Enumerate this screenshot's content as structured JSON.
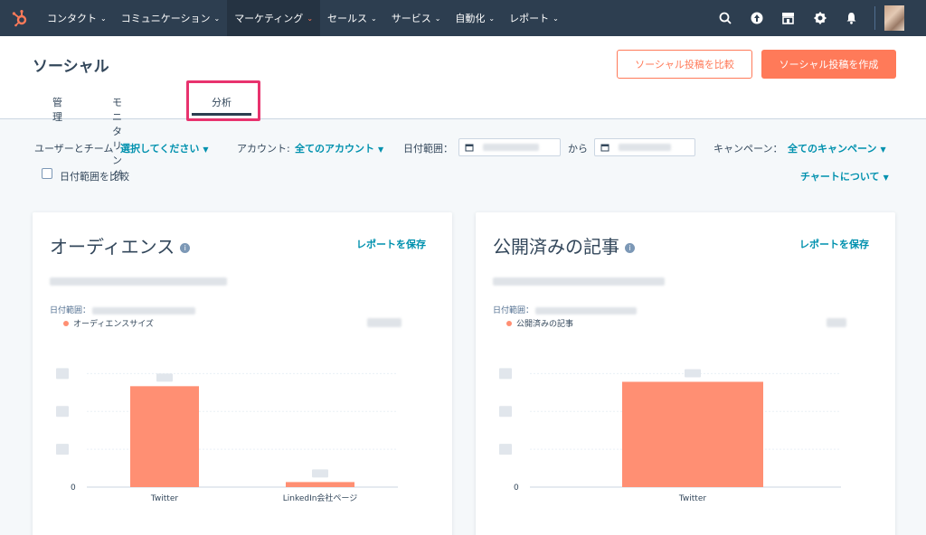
{
  "nav": {
    "items": [
      {
        "label": "コンタクト"
      },
      {
        "label": "コミュニケーション"
      },
      {
        "label": "マーケティング"
      },
      {
        "label": "セールス"
      },
      {
        "label": "サービス"
      },
      {
        "label": "自動化"
      },
      {
        "label": "レポート"
      }
    ],
    "active_index": 2,
    "icons": [
      "search-icon",
      "upgrade-icon",
      "marketplace-icon",
      "settings-icon",
      "notifications-icon"
    ],
    "colors": {
      "bg": "#2d3e50",
      "accent": "#ff7a59"
    }
  },
  "header": {
    "title": "ソーシャル",
    "compare_button": "ソーシャル投稿を比較",
    "create_button": "ソーシャル投稿を作成",
    "tabs": [
      {
        "label": "管理"
      },
      {
        "label": "モニタリング"
      },
      {
        "label": "分析"
      }
    ],
    "active_tab": 2
  },
  "filters": {
    "users_label": "ユーザーとチーム",
    "users_value": "選択してください",
    "account_label": "アカウント:",
    "account_value": "全てのアカウント",
    "date_label": "日付範囲：",
    "date_sep": "から",
    "campaign_label": "キャンペーン：",
    "campaign_value": "全てのキャンペーン",
    "compare_label": "日付範囲を比較",
    "compare_checked": false,
    "chart_about": "チャートについて"
  },
  "cards": [
    {
      "title": "オーディエンス",
      "save": "レポートを保存",
      "date_label": "日付範囲：",
      "legend": "オーディエンスサイズ",
      "chart_data": {
        "type": "bar",
        "categories": [
          "Twitter",
          "LinkedIn会社ページ"
        ],
        "values": [
          100,
          5
        ],
        "ylim": [
          0,
          120
        ],
        "y_tick_zero": "0",
        "grid": true,
        "color": "#ff8f73"
      }
    },
    {
      "title": "公開済みの記事",
      "save": "レポートを保存",
      "date_label": "日付範囲：",
      "legend": "公開済みの記事",
      "chart_data": {
        "type": "bar",
        "categories": [
          "Twitter"
        ],
        "values": [
          100
        ],
        "ylim": [
          0,
          115
        ],
        "y_tick_zero": "0",
        "grid": true,
        "color": "#ff8f73"
      }
    }
  ]
}
